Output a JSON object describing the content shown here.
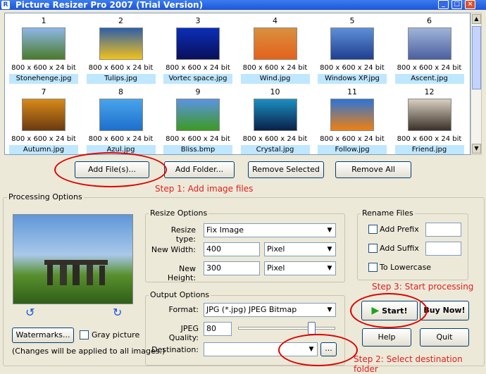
{
  "window": {
    "title": "Picture Resizer Pro 2007 (Trial Version)",
    "icon": "R",
    "minimize": "_",
    "maximize": "□",
    "close": "×"
  },
  "thumbnails": [
    {
      "num": "1",
      "dims": "800 x 600 x 24 bit",
      "file": "Stonehenge.jpg",
      "colors": [
        "#8db7e8",
        "#4a7a2a"
      ]
    },
    {
      "num": "2",
      "dims": "800 x 600 x 24 bit",
      "file": "Tulips.jpg",
      "colors": [
        "#2d5fa8",
        "#f2c21c"
      ]
    },
    {
      "num": "3",
      "dims": "800 x 600 x 24 bit",
      "file": "Vortec space.jpg",
      "colors": [
        "#0a2fb8",
        "#0a0f5a"
      ]
    },
    {
      "num": "4",
      "dims": "800 x 600 x 24 bit",
      "file": "Wind.jpg",
      "colors": [
        "#d99040",
        "#e3621a"
      ]
    },
    {
      "num": "5",
      "dims": "800 x 600 x 24 bit",
      "file": "Windows XP.jpg",
      "colors": [
        "#5e8fd8",
        "#1f3f90"
      ]
    },
    {
      "num": "6",
      "dims": "800 x 600 x 24 bit",
      "file": "Ascent.jpg",
      "colors": [
        "#9fb4d8",
        "#4b5fa0"
      ]
    },
    {
      "num": "7",
      "dims": "800 x 600 x 24 bit",
      "file": "Autumn.jpg",
      "colors": [
        "#d88a18",
        "#6a3a10"
      ]
    },
    {
      "num": "8",
      "dims": "800 x 600 x 24 bit",
      "file": "Azul.jpg",
      "colors": [
        "#49a4ea",
        "#1d6fcc"
      ]
    },
    {
      "num": "9",
      "dims": "800 x 600 x 24 bit",
      "file": "Bliss.bmp",
      "colors": [
        "#5b93e3",
        "#3c9a22"
      ]
    },
    {
      "num": "10",
      "dims": "800 x 600 x 24 bit",
      "file": "Crystal.jpg",
      "colors": [
        "#1c8ec0",
        "#0a2048"
      ]
    },
    {
      "num": "11",
      "dims": "800 x 600 x 24 bit",
      "file": "Follow.jpg",
      "colors": [
        "#2b74d8",
        "#f08010"
      ]
    },
    {
      "num": "12",
      "dims": "800 x 600 x 24 bit",
      "file": "Friend.jpg",
      "colors": [
        "#d8cfc0",
        "#3a3028"
      ]
    }
  ],
  "scroll": {
    "up": "▲",
    "down": "▼"
  },
  "buttons": {
    "add_files": "Add File(s)...",
    "add_folder": "Add Folder...",
    "remove_selected": "Remove Selected",
    "remove_all": "Remove All",
    "watermarks": "Watermarks...",
    "start": "Start!",
    "buy": "Buy Now!",
    "help": "Help",
    "quit": "Quit",
    "browse": "..."
  },
  "steps": {
    "step1": "Step 1: Add image files",
    "step2": "Step 2: Select destination folder",
    "step3": "Step 3: Start processing"
  },
  "processing": {
    "title": "Processing Options",
    "gray_label": "Gray picture",
    "note": "(Changes will be applied to all images.)",
    "rotate_left": "↺",
    "rotate_right": "↻"
  },
  "resize": {
    "title": "Resize Options",
    "type_label": "Resize type:",
    "type_value": "Fix Image",
    "width_label": "New Width:",
    "width_value": "400",
    "width_unit": "Pixel",
    "height_label": "New Height:",
    "height_value": "300",
    "height_unit": "Pixel"
  },
  "rename": {
    "title": "Rename Files",
    "prefix": "Add Prefix",
    "suffix": "Add Suffix",
    "lower": "To Lowercase"
  },
  "output": {
    "title": "Output Options",
    "format_label": "Format:",
    "format_value": "JPG (*.jpg) JPEG Bitmap",
    "quality_label": "JPEG Quality:",
    "quality_value": "80",
    "quality_level": 0.75,
    "dest_label": "Destination:",
    "dest_value": ""
  },
  "dropdown_arrow": "▼"
}
